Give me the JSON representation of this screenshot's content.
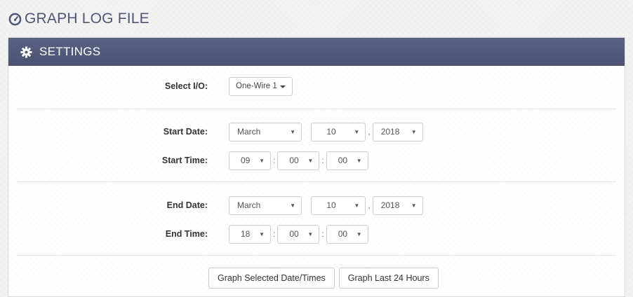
{
  "header": {
    "title": "GRAPH LOG FILE",
    "icon": "gauge-icon"
  },
  "panel": {
    "title": "SETTINGS",
    "icon": "gear-icon"
  },
  "io": {
    "label": "Select I/O:",
    "value": "One-Wire 1"
  },
  "start_date": {
    "label": "Start Date:",
    "month": "March",
    "day": "10",
    "separator": ",",
    "year": "2018"
  },
  "start_time": {
    "label": "Start Time:",
    "hour": "09",
    "minute": "00",
    "second": "00",
    "separator": ":"
  },
  "end_date": {
    "label": "End Date:",
    "month": "March",
    "day": "10",
    "separator": ",",
    "year": "2018"
  },
  "end_time": {
    "label": "End Time:",
    "hour": "18",
    "minute": "00",
    "second": "00",
    "separator": ":"
  },
  "buttons": {
    "graph_selected": "Graph Selected Date/Times",
    "graph_last_24": "Graph Last 24 Hours"
  },
  "colors": {
    "header_text": "#4e5577",
    "panel_heading": "#535a7a"
  }
}
